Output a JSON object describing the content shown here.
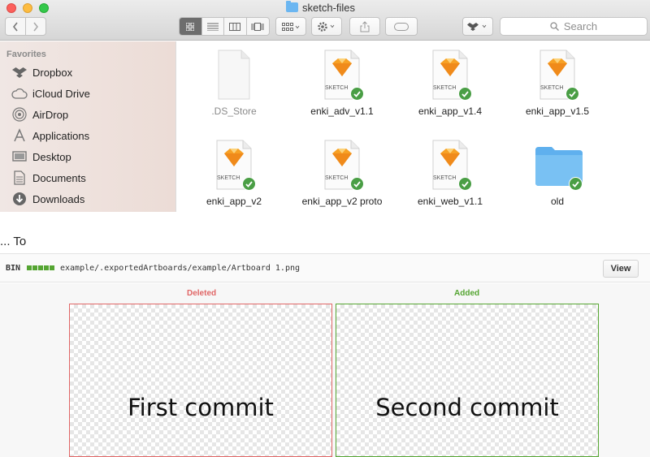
{
  "window": {
    "title": "sketch-files"
  },
  "toolbar": {
    "search_placeholder": "Search"
  },
  "sidebar": {
    "heading": "Favorites",
    "items": [
      {
        "label": "Dropbox",
        "icon": "dropbox-icon"
      },
      {
        "label": "iCloud Drive",
        "icon": "cloud-icon"
      },
      {
        "label": "AirDrop",
        "icon": "airdrop-icon"
      },
      {
        "label": "Applications",
        "icon": "applications-icon"
      },
      {
        "label": "Desktop",
        "icon": "desktop-icon"
      },
      {
        "label": "Documents",
        "icon": "documents-icon"
      },
      {
        "label": "Downloads",
        "icon": "downloads-icon"
      }
    ]
  },
  "files": [
    {
      "name": ".DS_Store",
      "kind": "blank-file",
      "synced": false
    },
    {
      "name": "enki_adv_v1.1",
      "kind": "sketch-file",
      "synced": true
    },
    {
      "name": "enki_app_v1.4",
      "kind": "sketch-file",
      "synced": true
    },
    {
      "name": "enki_app_v1.5",
      "kind": "sketch-file",
      "synced": true
    },
    {
      "name": "enki_app_v2",
      "kind": "sketch-file",
      "synced": true
    },
    {
      "name": "enki_app_v2 proto",
      "kind": "sketch-file",
      "synced": true
    },
    {
      "name": "enki_web_v1.1",
      "kind": "sketch-file",
      "synced": true
    },
    {
      "name": "old",
      "kind": "folder",
      "synced": true
    }
  ],
  "sketch_icon_text": "SKETCH",
  "diff": {
    "heading": "... To",
    "bin_label": "BIN",
    "path": "example/.exportedArtboards/example/Artboard 1.png",
    "view_label": "View",
    "deleted_label": "Deleted",
    "added_label": "Added",
    "deleted_text": "First commit",
    "added_text": "Second commit"
  },
  "colors": {
    "deleted": "#e06666",
    "added": "#55a532",
    "check": "#4a9e45",
    "sketch_orange": "#f7a125"
  }
}
